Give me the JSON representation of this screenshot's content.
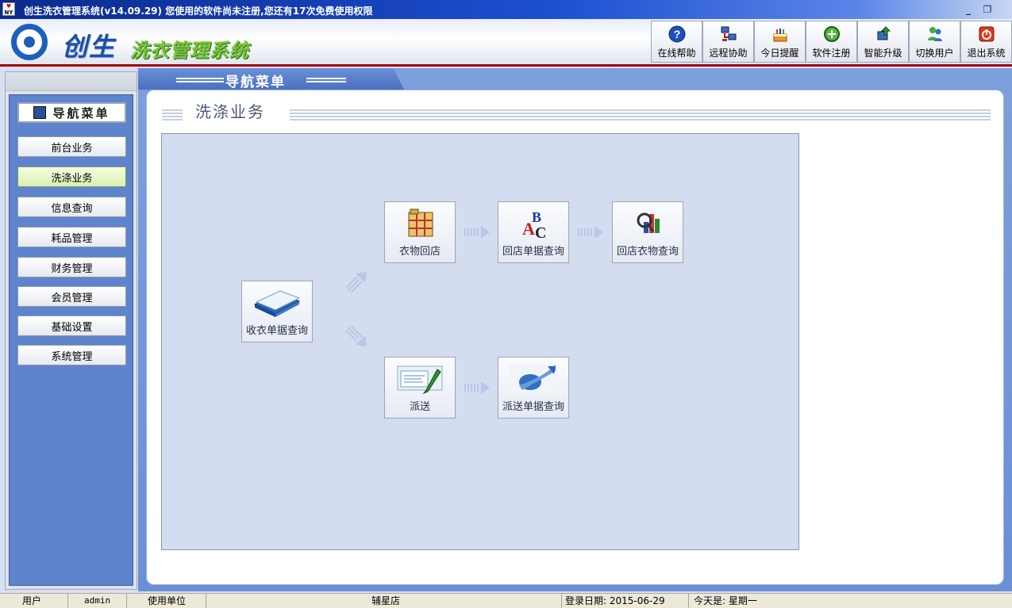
{
  "window": {
    "title": "创生洗衣管理系统(v14.09.29)  您使用的软件尚未注册,您还有17次免费使用权限",
    "app_icon_text": "NY",
    "minimize": "_",
    "restore": "❐"
  },
  "header": {
    "logo_text": "创生",
    "system_name": "洗衣管理系统",
    "toolbar": [
      {
        "label": "在线帮助",
        "icon": "help-icon"
      },
      {
        "label": "远程协助",
        "icon": "remote-computer-icon"
      },
      {
        "label": "今日提醒",
        "icon": "cake-icon"
      },
      {
        "label": "软件注册",
        "icon": "register-icon"
      },
      {
        "label": "智能升级",
        "icon": "upgrade-icon"
      },
      {
        "label": "切换用户",
        "icon": "switch-user-icon"
      },
      {
        "label": "退出系统",
        "icon": "power-icon"
      }
    ]
  },
  "sidebar": {
    "header": "导航菜单",
    "items": [
      {
        "label": "前台业务",
        "active": false
      },
      {
        "label": "洗涤业务",
        "active": true
      },
      {
        "label": "信息查询",
        "active": false
      },
      {
        "label": "耗品管理",
        "active": false
      },
      {
        "label": "财务管理",
        "active": false
      },
      {
        "label": "会员管理",
        "active": false
      },
      {
        "label": "基础设置",
        "active": false
      },
      {
        "label": "系统管理",
        "active": false
      }
    ]
  },
  "main": {
    "tab_title": "导航菜单",
    "section_title": "洗涤业务",
    "nodes": {
      "collect_query": "收衣单据查询",
      "return_store": "衣物回店",
      "return_query": "回店单据查询",
      "return_clothes_query": "回店衣物查询",
      "dispatch": "派送",
      "dispatch_query": "派送单据查询"
    }
  },
  "status": {
    "user_label": "用户",
    "user_value": "admin",
    "unit_label": "使用单位",
    "unit_value": "辅星店",
    "login_date": "登录日期: 2015-06-29",
    "today": "今天是: 星期一"
  },
  "colors": {
    "accent": "#5d84cc",
    "title_bar": "#1d4fd0",
    "header_rule": "#a40000",
    "diagram_bg": "#d4dcef",
    "active_nav": "#dcf0b4"
  }
}
